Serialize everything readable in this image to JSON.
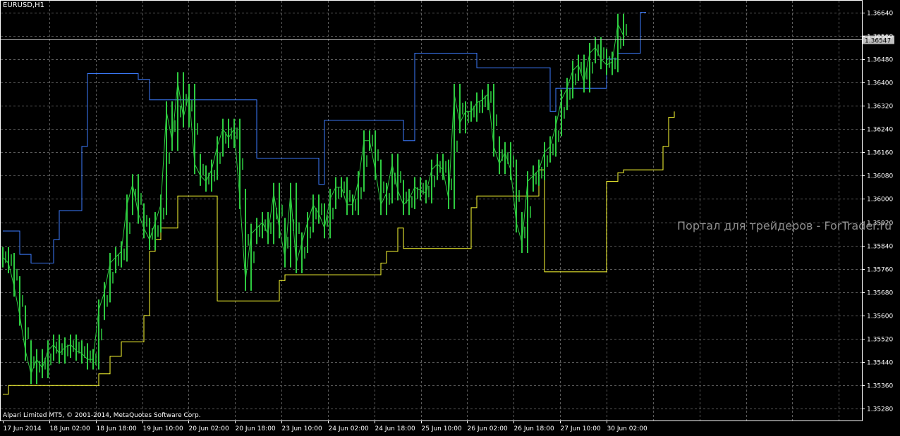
{
  "window": {
    "symbol_title": "EURUSD,H1",
    "copyright": "Alpari Limited MT5, © 2001-2014, MetaQuotes Software Corp.",
    "watermark": "Портал для трейдеров - ForTrader.ru"
  },
  "colors": {
    "background": "#000000",
    "grid": "#5a5a5a",
    "candles": "#2ecc40",
    "upper_channel": "#3c7cff",
    "lower_channel": "#ffff33",
    "axis_text": "#ffffff",
    "bid_line": "#c0c0c0"
  },
  "chart_data": {
    "type": "line",
    "symbol": "EURUSD",
    "timeframe": "H1",
    "ylim": [
      1.3524,
      1.3668
    ],
    "current_price": "1.36547",
    "y_ticks": [
      "1.36640",
      "1.36560",
      "1.36480",
      "1.36400",
      "1.36320",
      "1.36240",
      "1.36160",
      "1.36080",
      "1.36000",
      "1.35920",
      "1.35840",
      "1.35760",
      "1.35680",
      "1.35600",
      "1.35520",
      "1.35440",
      "1.35360",
      "1.35280"
    ],
    "x_ticks": [
      "17 Jun 2014",
      "18 Jun 02:00",
      "18 Jun 18:00",
      "19 Jun 10:00",
      "20 Jun 02:00",
      "20 Jun 18:00",
      "23 Jun 10:00",
      "24 Jun 02:00",
      "24 Jun 18:00",
      "25 Jun 10:00",
      "26 Jun 02:00",
      "26 Jun 18:00",
      "27 Jun 10:00",
      "30 Jun 02:00"
    ],
    "series": [
      {
        "values": [
          1.358,
          1.3578,
          1.357,
          1.356,
          1.3548,
          1.354,
          1.3545,
          1.3542,
          1.3548,
          1.355,
          1.3547,
          1.3549,
          1.355,
          1.3548,
          1.3547,
          1.3545,
          1.3545,
          1.3562,
          1.3568,
          1.3578,
          1.358,
          1.3582,
          1.3598,
          1.3605,
          1.3595,
          1.359,
          1.3586,
          1.3592,
          1.3598,
          1.363,
          1.362,
          1.364,
          1.3628,
          1.3636,
          1.3612,
          1.3608,
          1.3606,
          1.361,
          1.3618,
          1.3624,
          1.3621,
          1.3624,
          1.36,
          1.3572,
          1.3588,
          1.359,
          1.3592,
          1.3588,
          1.3602,
          1.359,
          1.358,
          1.3602,
          1.3578,
          1.3585,
          1.3592,
          1.3598,
          1.3595,
          1.359,
          1.36,
          1.3604,
          1.3604,
          1.3598,
          1.3598,
          1.3606,
          1.362,
          1.362,
          1.361,
          1.3598,
          1.3602,
          1.3612,
          1.3603,
          1.3598,
          1.36,
          1.3604,
          1.3603,
          1.3602,
          1.361,
          1.3612,
          1.361,
          1.36,
          1.3636,
          1.3626,
          1.363,
          1.363,
          1.3633,
          1.3634,
          1.3636,
          1.3618,
          1.3612,
          1.3616,
          1.361,
          1.3592,
          1.3585,
          1.3606,
          1.3608,
          1.361,
          1.3616,
          1.3618,
          1.3625,
          1.3634,
          1.3638,
          1.3644,
          1.3646,
          1.364,
          1.365,
          1.3652,
          1.3648,
          1.3646,
          1.3647,
          1.366,
          1.3656
        ],
        "upper": [
          1.3589,
          1.3589,
          1.3589,
          1.3581,
          1.3581,
          1.3578,
          1.3578,
          1.3578,
          1.3578,
          1.3586,
          1.3596,
          1.3596,
          1.3596,
          1.3596,
          1.3618,
          1.3643,
          1.3643,
          1.3643,
          1.3643,
          1.3643,
          1.3643,
          1.3643,
          1.3643,
          1.3643,
          1.3641,
          1.3641,
          1.3634,
          1.3634,
          1.3634,
          1.3634,
          1.3634,
          1.3634,
          1.3634,
          1.3634,
          1.3634,
          1.3634,
          1.3634,
          1.3634,
          1.3634,
          1.3634,
          1.3634,
          1.3634,
          1.3634,
          1.3634,
          1.3634,
          1.3614,
          1.3614,
          1.3614,
          1.3614,
          1.3614,
          1.3614,
          1.3614,
          1.3614,
          1.3614,
          1.3614,
          1.3614,
          1.3605,
          1.3627,
          1.3627,
          1.3627,
          1.3627,
          1.3627,
          1.3627,
          1.3627,
          1.3627,
          1.3627,
          1.3627,
          1.3627,
          1.3627,
          1.3627,
          1.3627,
          1.362,
          1.362,
          1.365,
          1.365,
          1.365,
          1.365,
          1.365,
          1.365,
          1.365,
          1.365,
          1.365,
          1.365,
          1.365,
          1.3645,
          1.3645,
          1.3645,
          1.3645,
          1.3645,
          1.3645,
          1.3645,
          1.3645,
          1.3645,
          1.3645,
          1.3645,
          1.3645,
          1.3645,
          1.363,
          1.3638,
          1.3638,
          1.3638,
          1.3638,
          1.3638,
          1.3638,
          1.3638,
          1.3638,
          1.3638,
          1.3648,
          1.3648,
          1.365,
          1.365,
          1.365,
          1.365,
          1.3664,
          1.3664
        ],
        "lower": [
          1.3533,
          1.3536,
          1.3536,
          1.3536,
          1.3536,
          1.3536,
          1.3536,
          1.3536,
          1.3536,
          1.3536,
          1.3536,
          1.3536,
          1.3536,
          1.3536,
          1.3536,
          1.3536,
          1.3536,
          1.354,
          1.354,
          1.3546,
          1.3546,
          1.3551,
          1.3551,
          1.3551,
          1.3551,
          1.356,
          1.3582,
          1.3586,
          1.359,
          1.359,
          1.359,
          1.3601,
          1.3601,
          1.3601,
          1.3601,
          1.3601,
          1.3601,
          1.3601,
          1.3565,
          1.3565,
          1.3565,
          1.3565,
          1.3565,
          1.3565,
          1.3565,
          1.3565,
          1.3565,
          1.3565,
          1.3565,
          1.3572,
          1.3574,
          1.3574,
          1.3574,
          1.3574,
          1.3574,
          1.3574,
          1.3574,
          1.3574,
          1.3574,
          1.3574,
          1.3574,
          1.3574,
          1.3574,
          1.3574,
          1.3574,
          1.3574,
          1.3574,
          1.3578,
          1.3582,
          1.3582,
          1.359,
          1.3583,
          1.3583,
          1.3583,
          1.3583,
          1.3583,
          1.3583,
          1.3583,
          1.3583,
          1.3583,
          1.3583,
          1.3583,
          1.3583,
          1.3597,
          1.3601,
          1.3601,
          1.3601,
          1.3601,
          1.3601,
          1.3601,
          1.3601,
          1.3601,
          1.3601,
          1.3601,
          1.3601,
          1.361,
          1.3575,
          1.3575,
          1.3575,
          1.3575,
          1.3575,
          1.3575,
          1.3575,
          1.3575,
          1.3575,
          1.3575,
          1.3575,
          1.3606,
          1.3606,
          1.3609,
          1.361,
          1.361,
          1.361,
          1.361,
          1.361,
          1.361,
          1.361,
          1.3618,
          1.3628,
          1.363
        ]
      }
    ]
  }
}
